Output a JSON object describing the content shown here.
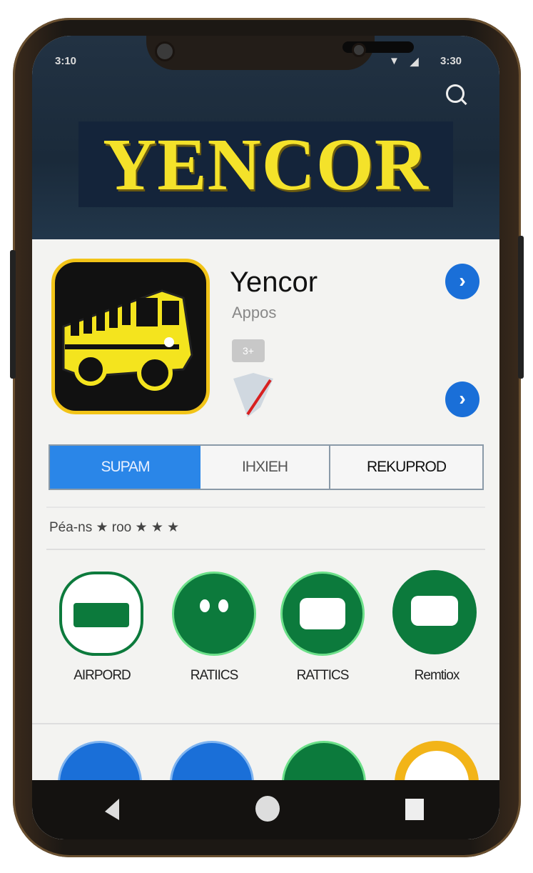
{
  "status_bar": {
    "left": "3:10",
    "time": "3:30",
    "icons": [
      "wifi-icon",
      "signal-icon"
    ]
  },
  "header": {
    "banner_text": "YENCOR",
    "search_icon": "search-icon"
  },
  "app": {
    "name": "Yencor",
    "category": "Appos",
    "badge": "3+",
    "icon": "school-bus-icon"
  },
  "tabs": [
    {
      "label": "SUPAM",
      "active": true
    },
    {
      "label": "IHXIEH",
      "active": false
    },
    {
      "label": "REKUPROD",
      "active": false
    }
  ],
  "rating_text": "Péa-ns ★ roo ★ ★ ★",
  "features": [
    {
      "label": "AIRPORD",
      "color": "#0c7a3c"
    },
    {
      "label": "RATIICS",
      "color": "#0c7a3c"
    },
    {
      "label": "RATTICS",
      "color": "#0c7a3c"
    },
    {
      "label": "Remtiox",
      "color": "#0c7a3c"
    }
  ],
  "second_row_colors": [
    "#1a6fd8",
    "#1a6fd8",
    "#0c7a3c",
    "#f2b418"
  ],
  "colors": {
    "accent": "#2a86e8",
    "banner_text": "#f4e22a",
    "header_bg": "#1a2a3a"
  },
  "nav": {
    "back": "back-icon",
    "home": "home-icon",
    "recents": "recents-icon"
  }
}
